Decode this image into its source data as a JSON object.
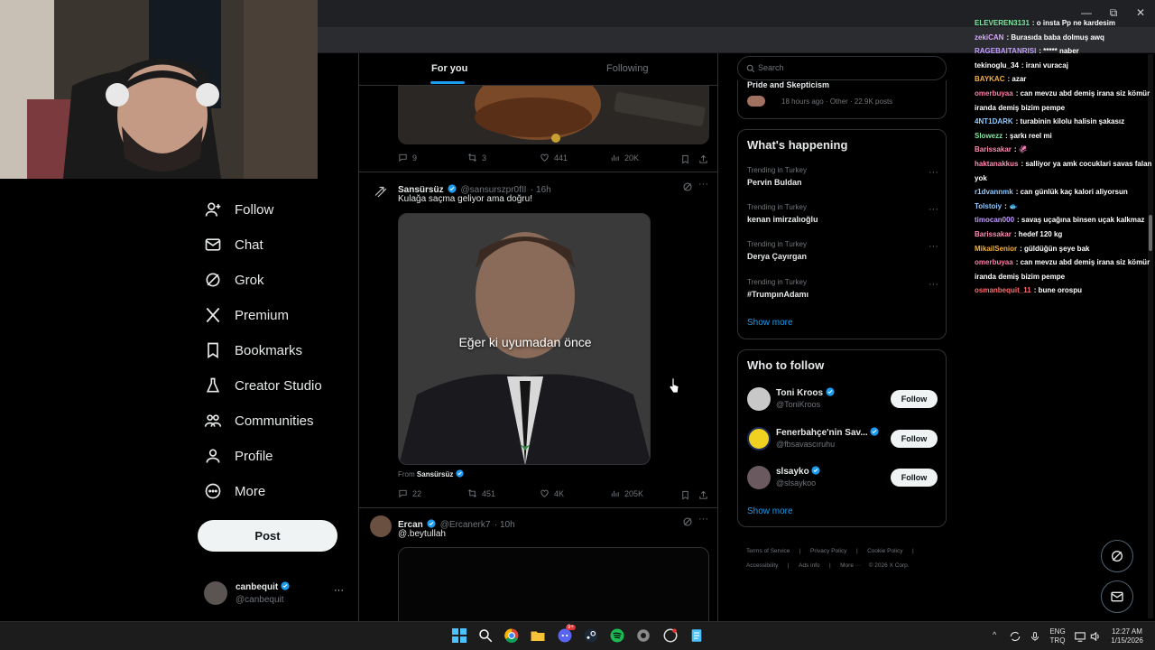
{
  "window": {
    "minimize": "—",
    "maximize": "⧉",
    "close": "✕"
  },
  "nav": {
    "items": [
      {
        "label": "Follow"
      },
      {
        "label": "Chat"
      },
      {
        "label": "Grok"
      },
      {
        "label": "Premium"
      },
      {
        "label": "Bookmarks"
      },
      {
        "label": "Creator Studio"
      },
      {
        "label": "Communities"
      },
      {
        "label": "Profile"
      },
      {
        "label": "More"
      }
    ],
    "post_label": "Post",
    "account": {
      "name": "canbequit",
      "handle": "@canbequit",
      "more": "···"
    }
  },
  "feed": {
    "tabs": {
      "for_you": "For you",
      "following": "Following"
    },
    "tweet1_stats": {
      "replies": "9",
      "retweets": "3",
      "likes": "441",
      "views": "20K"
    },
    "tweet2": {
      "name": "Sansürsüz",
      "handle": "@sansurszpr0fII",
      "time": "· 16h",
      "text": "Kulağa saçma geliyor ama doğru!",
      "caption": "Eğer ki uyumadan önce",
      "from_label": "From",
      "from_name": "Sansürsüz",
      "stats": {
        "replies": "22",
        "retweets": "451",
        "likes": "4K",
        "views": "205K"
      }
    },
    "tweet3": {
      "name": "Ercan",
      "handle": "@Ercanerk7",
      "time": "· 10h",
      "text": "@.beytullah"
    }
  },
  "sidebar": {
    "search_placeholder": "Search",
    "top_trend": {
      "name": "Pride and Skepticism",
      "meta": "18 hours ago · Other · 22.9K posts"
    },
    "whats_happening": {
      "title": "What's happening",
      "trends": [
        {
          "context": "Trending in Turkey",
          "name": "Pervin Buldan"
        },
        {
          "context": "Trending in Turkey",
          "name": "kenan imirzalıoğlu"
        },
        {
          "context": "Trending in Turkey",
          "name": "Derya Çayırgan"
        },
        {
          "context": "Trending in Turkey",
          "name": "#TrumpınAdamı"
        }
      ],
      "show_more": "Show more",
      "dots": "···"
    },
    "who_to_follow": {
      "title": "Who to follow",
      "users": [
        {
          "name": "Toni Kroos",
          "handle": "@ToniKroos"
        },
        {
          "name": "Fenerbahçe'nin Sav...",
          "handle": "@fbsavascıruhu"
        },
        {
          "name": "slsayko",
          "handle": "@slsaykoo"
        }
      ],
      "follow_label": "Follow",
      "show_more": "Show more"
    },
    "footer": {
      "line1": [
        "Terms of Service",
        "|",
        "Privacy Policy",
        "|",
        "Cookie Policy",
        "|"
      ],
      "line2": [
        "Accessibility",
        "|",
        "Ads info",
        "|",
        "More ···",
        "© 2026 X Corp."
      ]
    }
  },
  "chat": [
    {
      "user": "ELEVEREN3131",
      "color": "#7ee8a2",
      "msg": ": o insta Pp ne kardesim"
    },
    {
      "user": "zekiCAN",
      "color": "#d9a8ff",
      "msg": ": Burasıda baba dolmuş awq"
    },
    {
      "user": "RAGEBAITANRISI",
      "color": "#c19cff",
      "msg": ": ***** naber"
    },
    {
      "user": "tekinoglu_34",
      "color": "#ffffff",
      "msg": ": irani vuracaj"
    },
    {
      "user": "BAYKAC",
      "color": "#f5b041",
      "msg": ": azar"
    },
    {
      "user": "omerbuyaa",
      "color": "#ff7aa8",
      "msg": ": can mevzu abd demiş irana siz kömür iranda demiş bizim pempe"
    },
    {
      "user": "4NT1DARK",
      "color": "#8fc9ff",
      "msg": ": turabinin kilolu halisin şakasız"
    },
    {
      "user": "Slowezz",
      "color": "#7ee8a2",
      "msg": ": şarkı reel mi"
    },
    {
      "user": "Barissakar",
      "color": "#ff8ab3",
      "msg": ": 🦑"
    },
    {
      "user": "haktanakkus",
      "color": "#ff8ab3",
      "msg": ": salliyor ya amk cocuklari savas falan yok"
    },
    {
      "user": "r1dvannmk",
      "color": "#8fc9ff",
      "msg": ": can günlük kaç kalori aliyorsun"
    },
    {
      "user": "Tolstoiy",
      "color": "#8fc9ff",
      "msg": ": 🐟"
    },
    {
      "user": "timocan000",
      "color": "#c19cff",
      "msg": ": savaş uçağına binsen uçak kalkmaz"
    },
    {
      "user": "Barissakar",
      "color": "#ff8ab3",
      "msg": ": hedef 120 kg"
    },
    {
      "user": "MikailSenior",
      "color": "#f5b041",
      "msg": ": güldüğün şeye bak"
    },
    {
      "user": "omerbuyaa",
      "color": "#ff7aa8",
      "msg": ": can mevzu abd demiş irana siz kömür iranda demiş bizim pempe"
    },
    {
      "user": "osmanbequit_11",
      "color": "#ff6b6b",
      "msg": ": bune orospu"
    }
  ],
  "taskbar": {
    "lang_top": "ENG",
    "lang_bottom": "TRQ",
    "time": "12:27 AM",
    "date": "1/15/2026",
    "badge": "9+"
  },
  "colors": {
    "accent": "#1d9bf0",
    "background": "#000000",
    "border": "#2f3336"
  }
}
